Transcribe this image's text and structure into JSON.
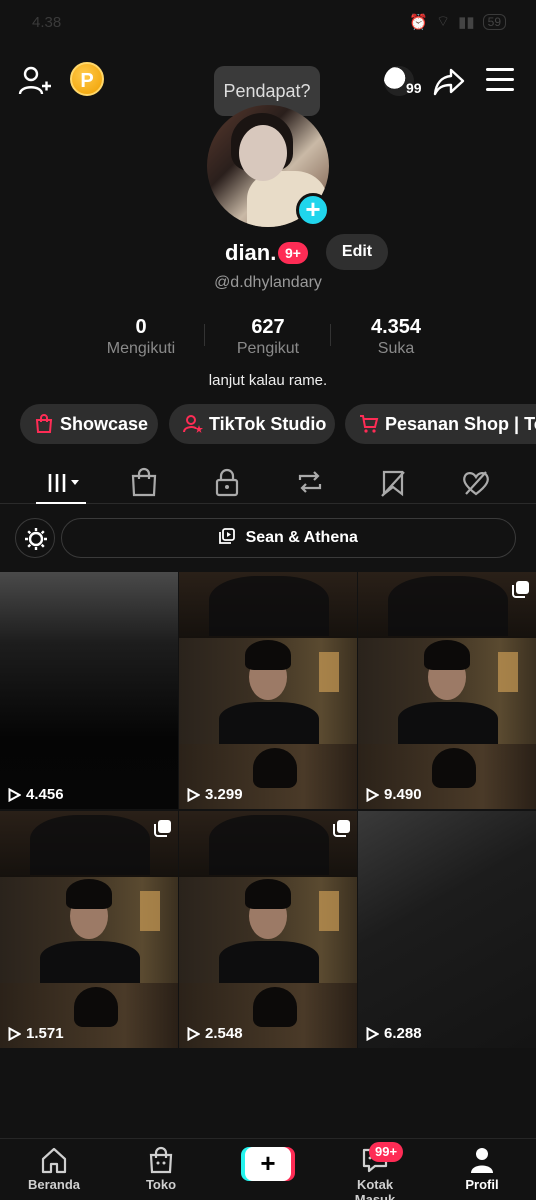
{
  "status_bar": {
    "time": "4.38",
    "battery": "59"
  },
  "top_bar": {
    "coin_letter": "P",
    "tooltip": "Pendapat?",
    "friends_count": "99"
  },
  "profile": {
    "name": "dian.",
    "name_badge": "9+",
    "edit_label": "Edit",
    "handle": "@d.dhylandary",
    "bio": "lanjut kalau rame."
  },
  "stats": [
    {
      "value": "0",
      "label": "Mengikuti"
    },
    {
      "value": "627",
      "label": "Pengikut"
    },
    {
      "value": "4.354",
      "label": "Suka"
    }
  ],
  "chips": [
    {
      "label": "Showcase",
      "icon": "shopping-bag-icon"
    },
    {
      "label": "TikTok Studio",
      "icon": "person-star-icon"
    },
    {
      "label": "Pesanan Shop | To",
      "icon": "shopping-cart-icon"
    }
  ],
  "tabs": [
    "videos-grid-icon",
    "shop-bag-icon",
    "lock-icon",
    "repost-icon",
    "saved-bookmark-icon",
    "liked-heart-icon"
  ],
  "playlist": {
    "label": "Sean & Athena"
  },
  "videos": [
    {
      "views": "4.456",
      "multi": false
    },
    {
      "views": "3.299",
      "multi": false
    },
    {
      "views": "9.490",
      "multi": true
    },
    {
      "views": "1.571",
      "multi": true
    },
    {
      "views": "2.548",
      "multi": true
    },
    {
      "views": "6.288",
      "multi": false
    }
  ],
  "nav": {
    "home": "Beranda",
    "shop": "Toko",
    "create": "+",
    "inbox": "Kotak Masuk",
    "inbox_badge": "99+",
    "profile": "Profil"
  },
  "colors": {
    "accent": "#fe2c55",
    "cyan": "#20d5ec",
    "background": "#121212"
  }
}
